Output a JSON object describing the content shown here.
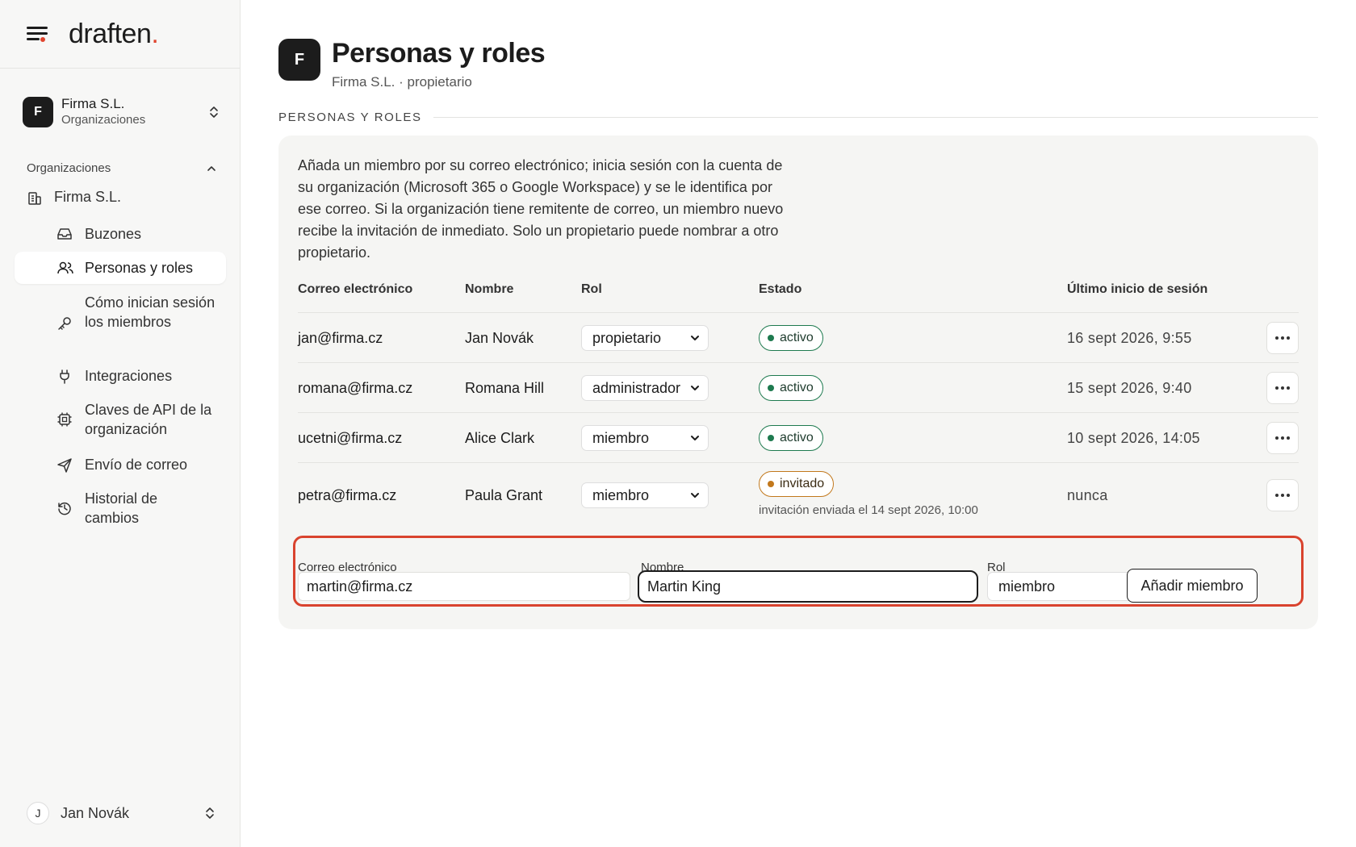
{
  "brand": {
    "name": "draften",
    "dot": "."
  },
  "org_switcher": {
    "avatar": "F",
    "name": "Firma S.L.",
    "sub": "Organizaciones"
  },
  "sidebar": {
    "section_label": "Organizaciones",
    "org_item": "Firma S.L.",
    "items": [
      {
        "label": "Buzones"
      },
      {
        "label": "Personas y roles"
      },
      {
        "label": "Cómo inician sesión los miembros"
      },
      {
        "label": "Integraciones"
      },
      {
        "label": "Claves de API de la organización"
      },
      {
        "label": "Envío de correo"
      },
      {
        "label": "Historial de cambios"
      }
    ],
    "user": {
      "initial": "J",
      "name": "Jan Novák"
    }
  },
  "header": {
    "avatar": "F",
    "title": "Personas y roles",
    "subtitle": "Firma S.L. · propietario"
  },
  "section_title": "PERSONAS Y ROLES",
  "intro": "Añada un miembro por su correo electrónico; inicia sesión con la cuenta de su organización (Microsoft 365 o Google Workspace) y se le identifica por ese correo. Si la organización tiene remitente de correo, un miembro nuevo recibe la invitación de inmediato. Solo un propietario puede nombrar a otro propietario.",
  "table": {
    "columns": [
      "Correo electrónico",
      "Nombre",
      "Rol",
      "Estado",
      "Último inicio de sesión"
    ],
    "rows": [
      {
        "email": "jan@firma.cz",
        "name": "Jan Novák",
        "role": "propietario",
        "status": "activo",
        "last": "16 sept 2026, 9:55"
      },
      {
        "email": "romana@firma.cz",
        "name": "Romana Hill",
        "role": "administrador",
        "status": "activo",
        "last": "15 sept 2026, 9:40"
      },
      {
        "email": "ucetni@firma.cz",
        "name": "Alice Clark",
        "role": "miembro",
        "status": "activo",
        "last": "10 sept 2026, 14:05"
      },
      {
        "email": "petra@firma.cz",
        "name": "Paula Grant",
        "role": "miembro",
        "status": "invitado",
        "status_note": "invitación enviada el 14 sept 2026, 10:00",
        "last": "nunca"
      }
    ]
  },
  "add_form": {
    "email_label": "Correo electrónico",
    "email_value": "martin@firma.cz",
    "name_label": "Nombre",
    "name_value": "Martin King",
    "role_label": "Rol",
    "role_value": "miembro",
    "submit_label": "Añadir miembro"
  },
  "colors": {
    "accent": "#e0452f",
    "active_green": "#1e7a4f",
    "invited_orange": "#c2781c",
    "highlight_border": "#d9432e"
  }
}
